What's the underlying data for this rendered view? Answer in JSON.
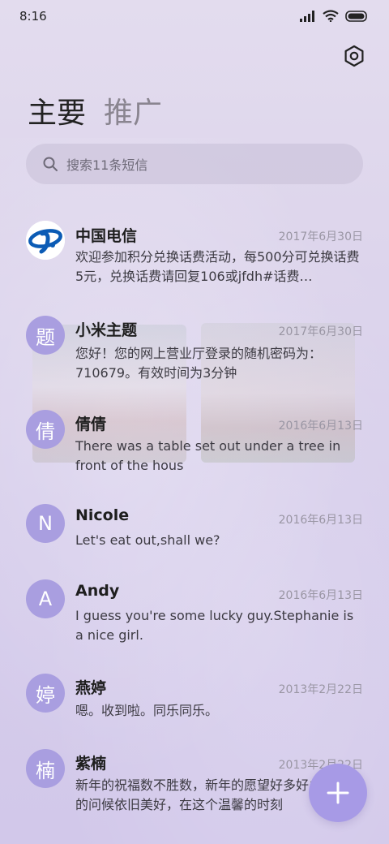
{
  "status_bar": {
    "time": "8:16"
  },
  "tabs": [
    {
      "label": "主要"
    },
    {
      "label": "推广"
    }
  ],
  "search": {
    "placeholder": "搜索11条短信"
  },
  "conversations": [
    {
      "name": "中国电信",
      "avatar": "",
      "date": "2017年6月30日",
      "preview": "欢迎参加积分兑换话费活动，每500分可兑换话费5元，兑换话费请回复106或jfdh#话费…"
    },
    {
      "name": "小米主题",
      "avatar": "题",
      "date": "2017年6月30日",
      "preview": "您好！您的网上营业厅登录的随机密码为：710679。有效时间为3分钟"
    },
    {
      "name": "倩倩",
      "avatar": "倩",
      "date": "2016年6月13日",
      "preview": "There was a table set out under a tree in front of the hous"
    },
    {
      "name": "Nicole",
      "avatar": "N",
      "date": "2016年6月13日",
      "preview": "Let's eat out,shall we?"
    },
    {
      "name": "Andy",
      "avatar": "A",
      "date": "2016年6月13日",
      "preview": "I guess you're some lucky guy.Stephanie is a nice girl."
    },
    {
      "name": "燕婷",
      "avatar": "婷",
      "date": "2013年2月22日",
      "preview": "嗯。收到啦。同乐同乐。"
    },
    {
      "name": "紫楠",
      "avatar": "楠",
      "date": "2013年2月22日",
      "preview": "新年的祝福数不胜数，新年的愿望好多好多，新年的问候依旧美好，在这个温馨的时刻"
    }
  ],
  "icons": {
    "settings": "settings-icon",
    "search": "search-icon",
    "compose": "plus-icon",
    "carrier_logo": "china-telecom-logo"
  },
  "colors": {
    "accent": "#a99ee0",
    "fab": "#a79ae6"
  }
}
